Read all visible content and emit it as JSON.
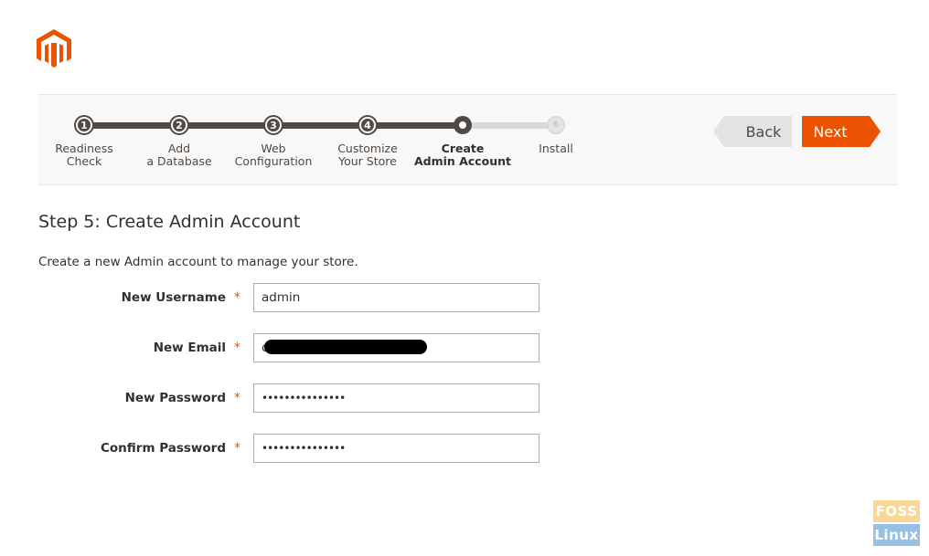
{
  "brand": {
    "accent": "#eb5202",
    "dark": "#514943"
  },
  "wizard": {
    "steps": [
      {
        "number": "1",
        "label": "Readiness\nCheck",
        "state": "done"
      },
      {
        "number": "2",
        "label": "Add\na Database",
        "state": "done"
      },
      {
        "number": "3",
        "label": "Web\nConfiguration",
        "state": "done"
      },
      {
        "number": "4",
        "label": "Customize\nYour Store",
        "state": "done"
      },
      {
        "number": "5",
        "label": "Create\nAdmin Account",
        "state": "current"
      },
      {
        "number": "6",
        "label": "Install",
        "state": "todo"
      }
    ],
    "back_label": "Back",
    "next_label": "Next"
  },
  "page": {
    "heading": "Step 5: Create Admin Account",
    "intro": "Create a new Admin account to manage your store."
  },
  "form": {
    "required_mark": "*",
    "username": {
      "label": "New Username",
      "value": "admin"
    },
    "email": {
      "label": "New Email",
      "value": "c"
    },
    "password": {
      "label": "New Password",
      "value": "•••••••••••••••"
    },
    "confirm": {
      "label": "Confirm Password",
      "value": "•••••••••••••••"
    }
  },
  "watermark": {
    "top": "FOSS",
    "bottom": "Linux"
  }
}
